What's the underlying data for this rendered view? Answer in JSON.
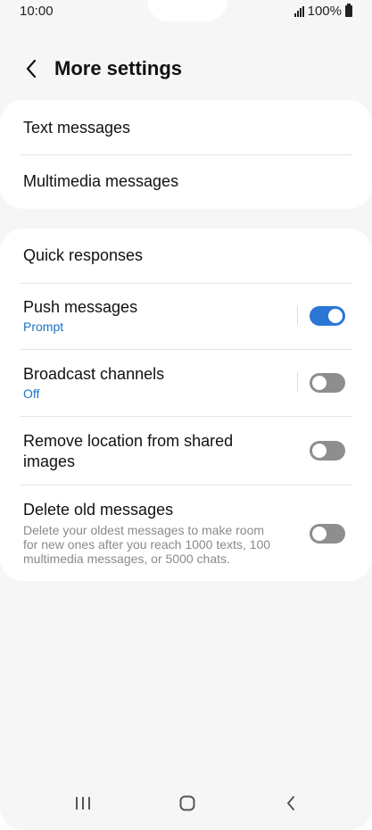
{
  "status_bar": {
    "time": "10:00",
    "battery": "100%"
  },
  "header": {
    "title": "More settings"
  },
  "group1": {
    "items": [
      {
        "title": "Text messages"
      },
      {
        "title": "Multimedia messages"
      }
    ]
  },
  "group2": {
    "quick_responses": {
      "title": "Quick responses"
    },
    "push_messages": {
      "title": "Push messages",
      "subtitle": "Prompt",
      "enabled": true
    },
    "broadcast_channels": {
      "title": "Broadcast channels",
      "subtitle": "Off",
      "enabled": false
    },
    "remove_location": {
      "title": "Remove location from shared images",
      "enabled": false
    },
    "delete_old": {
      "title": "Delete old messages",
      "description": "Delete your oldest messages to make room for new ones after you reach 1000 texts, 100 multimedia messages, or 5000 chats.",
      "enabled": false
    }
  },
  "colors": {
    "accent": "#2b77d3",
    "toggle_off": "#8e8e8e",
    "link_blue": "#1a73c9",
    "background": "#f6f6f6"
  },
  "icons": {
    "back": "chevron-left-icon",
    "recents": "recents-icon",
    "home": "home-icon",
    "nav_back": "nav-back-icon"
  }
}
